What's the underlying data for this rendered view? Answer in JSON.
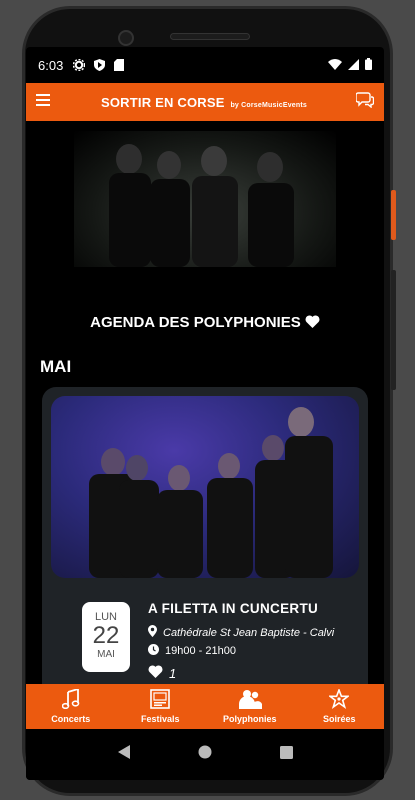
{
  "status": {
    "time": "6:03"
  },
  "appbar": {
    "title": "SORTIR EN CORSE",
    "byline": "by CorseMusicEvents"
  },
  "agenda": {
    "title": "AGENDA DES POLYPHONIES"
  },
  "month": "MAI",
  "event": {
    "dow": "LUN",
    "day": "22",
    "month": "MAI",
    "title": "A FILETTA IN CUNCERTU",
    "location": "Cathédrale St Jean Baptiste - Calvi",
    "time": "19h00 - 21h00",
    "likes": "1"
  },
  "tabs": [
    {
      "label": "Concerts",
      "icon": "music-note-icon"
    },
    {
      "label": "Festivals",
      "icon": "picture-icon"
    },
    {
      "label": "Polyphonies",
      "icon": "group-icon"
    },
    {
      "label": "Soirées",
      "icon": "star-icon"
    }
  ],
  "colors": {
    "accent": "#ec5a0f",
    "card": "#1f2327"
  }
}
